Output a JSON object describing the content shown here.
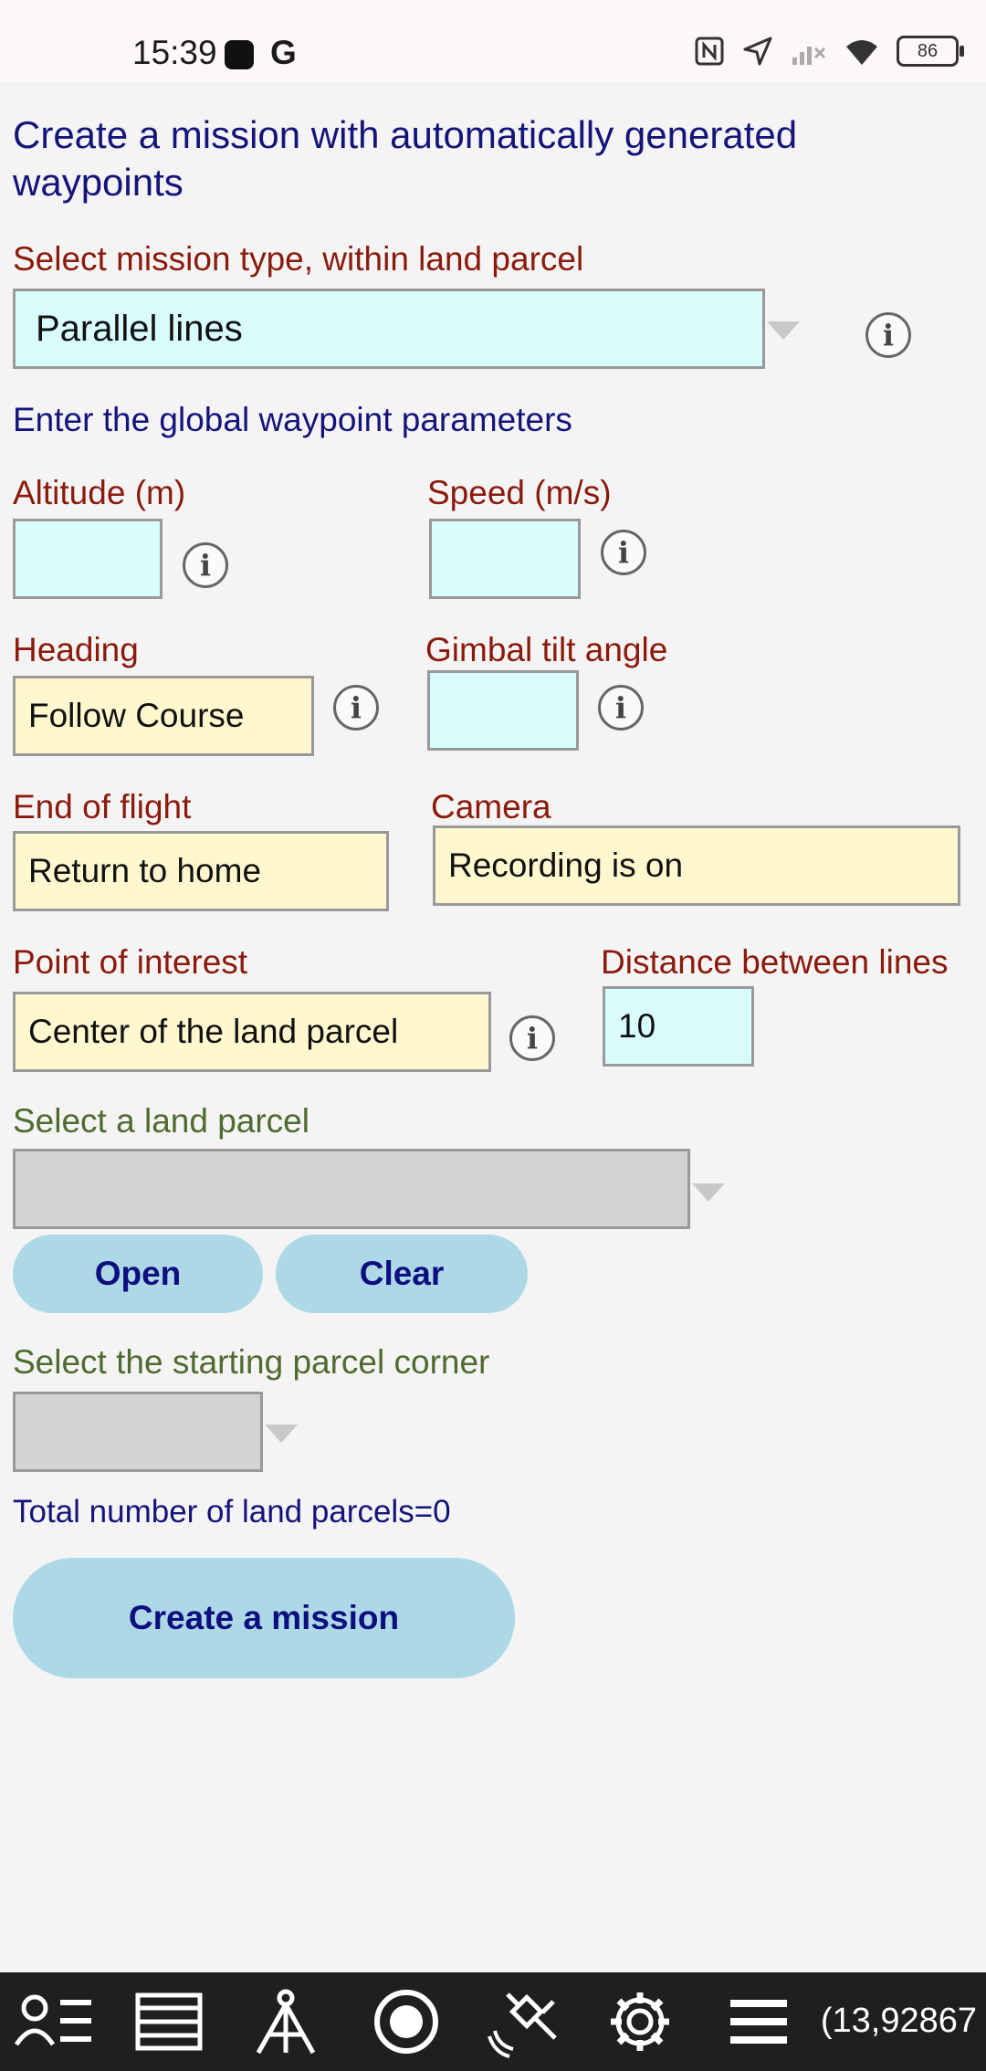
{
  "status": {
    "time": "15:39",
    "app_letter": "G",
    "battery": "86"
  },
  "title": "Create a mission with automatically generated waypoints",
  "mission_type": {
    "label": "Select mission type, within land parcel",
    "value": "Parallel lines"
  },
  "global_params_label": "Enter the global waypoint parameters",
  "altitude": {
    "label": "Altitude (m)",
    "value": ""
  },
  "speed": {
    "label": "Speed (m/s)",
    "value": ""
  },
  "heading": {
    "label": "Heading",
    "value": "Follow Course"
  },
  "gimbal": {
    "label": "Gimbal tilt angle",
    "value": ""
  },
  "end_of_flight": {
    "label": "End of flight",
    "value": "Return to home"
  },
  "camera": {
    "label": "Camera",
    "value": "Recording is on"
  },
  "poi": {
    "label": "Point of interest",
    "value": "Center of the land parcel"
  },
  "distance": {
    "label": "Distance between lines",
    "value": "10"
  },
  "land_parcel": {
    "label": "Select a land parcel",
    "value": ""
  },
  "buttons": {
    "open": "Open",
    "clear": "Clear",
    "create": "Create a mission"
  },
  "corner": {
    "label": "Select the starting parcel corner",
    "value": ""
  },
  "total_parcels": "Total number of land parcels=0",
  "navbar": {
    "icons": [
      "list-user-icon",
      "layers-icon",
      "tripod-icon",
      "record-icon",
      "satellite-icon",
      "gear-icon",
      "menu-icon"
    ],
    "coords": "(13,92867"
  },
  "colors": {
    "input_cyan": "#d9fdfd",
    "input_yellow": "#fff8cf",
    "input_gray": "#d3d3d3",
    "button_blue": "#add8e6",
    "label_red": "#8b1a0c",
    "label_blue": "#14147a",
    "label_green": "#4f6b2f"
  }
}
